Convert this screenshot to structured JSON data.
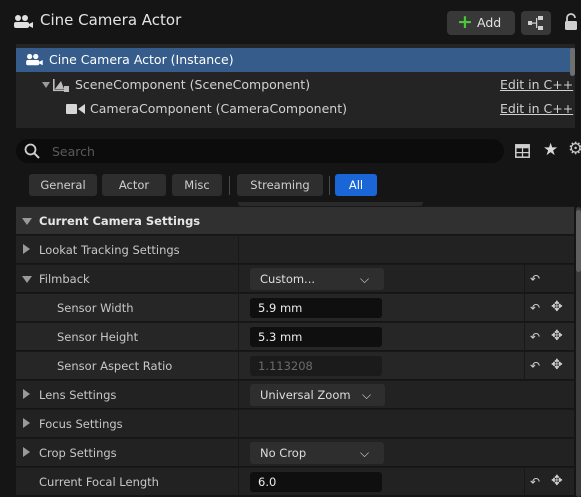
{
  "header": {
    "title": "Cine Camera Actor",
    "add_label": "Add",
    "add_glyph": "+"
  },
  "tree": {
    "rows": [
      {
        "label": "Cine Camera Actor (Instance)",
        "icon": "actor-icon",
        "edit": ""
      },
      {
        "label": "SceneComponent (SceneComponent)",
        "icon": "scene-component-icon",
        "edit": "Edit in C++"
      },
      {
        "label": "CameraComponent (CameraComponent)",
        "icon": "camera-icon",
        "edit": "Edit in C++"
      }
    ]
  },
  "search": {
    "placeholder": "Search",
    "value": ""
  },
  "tabs": [
    {
      "label": "General",
      "active": false
    },
    {
      "label": "Actor",
      "active": false
    },
    {
      "label": "Misc",
      "active": false
    },
    {
      "label": "Streaming",
      "active": false
    },
    {
      "label": "All",
      "active": true
    }
  ],
  "properties": {
    "category": "Current Camera Settings",
    "lookat": "Lookat Tracking Settings",
    "filmback": {
      "label": "Filmback",
      "value": "Custom..."
    },
    "sensor_width": {
      "label": "Sensor Width",
      "value": "5.9 mm"
    },
    "sensor_height": {
      "label": "Sensor Height",
      "value": "5.3 mm"
    },
    "sensor_aspect": {
      "label": "Sensor Aspect Ratio",
      "value": "1.113208"
    },
    "lens": {
      "label": "Lens Settings",
      "value": "Universal Zoom"
    },
    "focus": {
      "label": "Focus Settings"
    },
    "crop": {
      "label": "Crop Settings",
      "value": "No Crop"
    },
    "focal": {
      "label": "Current Focal Length",
      "value": "6.0"
    },
    "reset_glyph": "↶",
    "pin_glyph": "✥"
  },
  "colors": {
    "background": "#151515",
    "selection": "#355c8a",
    "accent_tab": "#1a66d6",
    "add_plus": "#4ec43a"
  }
}
